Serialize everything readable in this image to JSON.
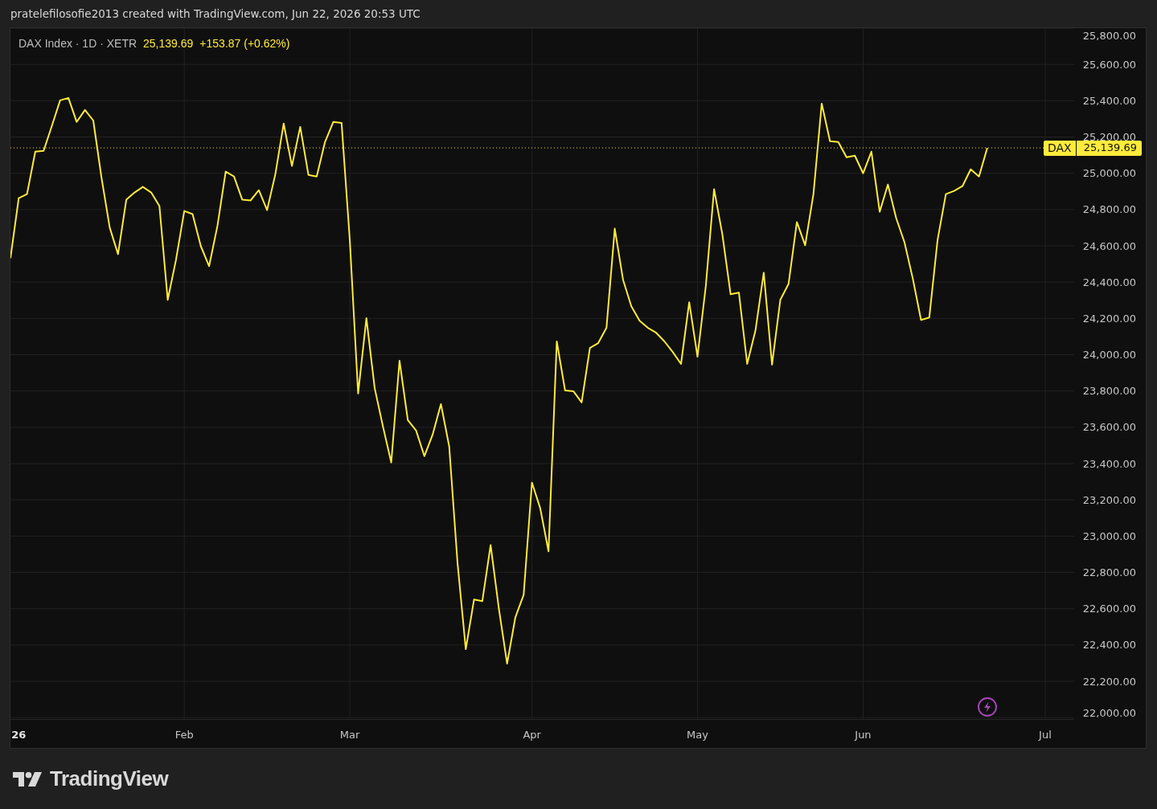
{
  "header": {
    "caption": "pratelefilosofie2013 created with TradingView.com, Jun 22, 2026 20:53 UTC"
  },
  "chart": {
    "legend": {
      "symbol": "DAX Index · 1D · XETR",
      "price": "25,139.69",
      "change": "+153.87 (+0.62%)"
    },
    "last_price_badge": {
      "price": "25,139.69"
    },
    "chart_data": {
      "type": "line",
      "categories": [
        null,
        "26",
        null,
        null,
        null,
        null,
        null,
        null,
        null,
        null,
        null,
        null,
        null,
        null,
        null,
        null,
        null,
        null,
        null,
        null,
        null,
        "Feb",
        null,
        null,
        null,
        null,
        null,
        null,
        null,
        null,
        null,
        null,
        null,
        null,
        null,
        null,
        null,
        null,
        null,
        null,
        null,
        "Mar",
        null,
        null,
        null,
        null,
        null,
        null,
        null,
        null,
        null,
        null,
        null,
        null,
        null,
        null,
        null,
        null,
        null,
        null,
        null,
        null,
        null,
        "Apr",
        null,
        null,
        null,
        null,
        null,
        null,
        null,
        null,
        null,
        null,
        null,
        null,
        null,
        null,
        null,
        null,
        null,
        null,
        null,
        "May",
        null,
        null,
        null,
        null,
        null,
        null,
        null,
        null,
        null,
        null,
        null,
        null,
        null,
        null,
        null,
        null,
        null,
        null,
        null,
        "Jun",
        null,
        null,
        null,
        null,
        null,
        null,
        null,
        null,
        null,
        null,
        null,
        null,
        null,
        null,
        null,
        null,
        null,
        null,
        null,
        null,
        null,
        "Jul",
        null,
        null,
        null
      ],
      "series": [
        {
          "name": "DAX",
          "color": "#ffeb3b",
          "values": [
            24532,
            24863,
            24885,
            25119,
            25124,
            25261,
            25402,
            25415,
            25283,
            25349,
            25291,
            24974,
            24700,
            24554,
            24854,
            24894,
            24925,
            24894,
            24819,
            24302,
            24523,
            24792,
            24775,
            24598,
            24488,
            24709,
            25009,
            24982,
            24854,
            24850,
            24907,
            24797,
            24996,
            25274,
            25040,
            25256,
            24991,
            24982,
            25172,
            25283,
            25278,
            24629,
            23786,
            24201,
            23816,
            23604,
            23406,
            23967,
            23640,
            23582,
            23441,
            23560,
            23728,
            23494,
            22854,
            22377,
            22651,
            22642,
            22951,
            22602,
            22297,
            22553,
            22677,
            23295,
            23154,
            22916,
            24073,
            23803,
            23799,
            23737,
            24037,
            24064,
            24148,
            24695,
            24413,
            24267,
            24187,
            24148,
            24121,
            24073,
            24015,
            23949,
            24289,
            23989,
            24377,
            24912,
            24664,
            24333,
            24342,
            23949,
            24134,
            24452,
            23945,
            24302,
            24391,
            24731,
            24603,
            24885,
            25384,
            25177,
            25172,
            25088,
            25097,
            25000,
            25119,
            24788,
            24938,
            24753,
            24620,
            24421,
            24192,
            24205,
            24633,
            24885,
            24903,
            24929,
            25022,
            24982,
            25140,
            null,
            null,
            null,
            null,
            null,
            null,
            null,
            null,
            null,
            null
          ]
        }
      ],
      "ylim": [
        21992,
        25800
      ],
      "yticks": [
        {
          "value": 22000,
          "label": "22,000.00"
        },
        {
          "value": 22200,
          "label": "22,200.00"
        },
        {
          "value": 22400,
          "label": "22,400.00"
        },
        {
          "value": 22600,
          "label": "22,600.00"
        },
        {
          "value": 22800,
          "label": "22,800.00"
        },
        {
          "value": 23000,
          "label": "23,000.00"
        },
        {
          "value": 23200,
          "label": "23,200.00"
        },
        {
          "value": 23400,
          "label": "23,400.00"
        },
        {
          "value": 23600,
          "label": "23,600.00"
        },
        {
          "value": 23800,
          "label": "23,800.00"
        },
        {
          "value": 24000,
          "label": "24,000.00"
        },
        {
          "value": 24200,
          "label": "24,200.00"
        },
        {
          "value": 24400,
          "label": "24,400.00"
        },
        {
          "value": 24600,
          "label": "24,600.00"
        },
        {
          "value": 24800,
          "label": "24,800.00"
        },
        {
          "value": 25000,
          "label": "25,000.00"
        },
        {
          "value": 25200,
          "label": "25,200.00"
        },
        {
          "value": 25400,
          "label": "25,400.00"
        },
        {
          "value": 25600,
          "label": "25,600.00"
        },
        {
          "value": 25800,
          "label": "25,800.00"
        }
      ],
      "grid": true
    }
  },
  "footer": {
    "logo_text": "TradingView"
  }
}
